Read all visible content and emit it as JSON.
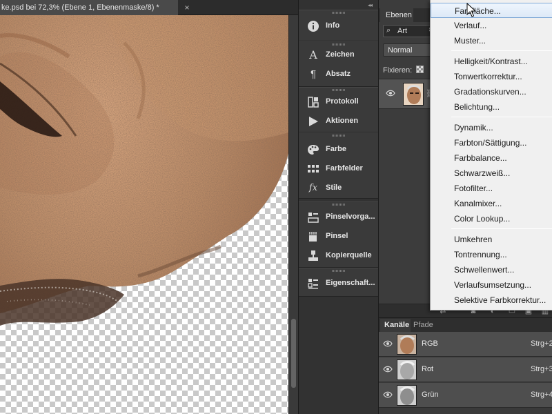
{
  "document": {
    "tab_title": "ke.psd bei 72,3% (Ebene 1, Ebenenmaske/8) *",
    "close_glyph": "×"
  },
  "dock": {
    "collapse_glyph": "◂◂",
    "groups": [
      {
        "items": [
          {
            "label": "Info",
            "icon": "info-icon"
          }
        ]
      },
      {
        "items": [
          {
            "label": "Zeichen",
            "icon": "character-icon"
          },
          {
            "label": "Absatz",
            "icon": "paragraph-icon"
          }
        ]
      },
      {
        "items": [
          {
            "label": "Protokoll",
            "icon": "history-icon"
          },
          {
            "label": "Aktionen",
            "icon": "actions-play-icon"
          }
        ]
      },
      {
        "items": [
          {
            "label": "Farbe",
            "icon": "color-palette-icon"
          },
          {
            "label": "Farbfelder",
            "icon": "swatches-icon"
          },
          {
            "label": "Stile",
            "icon": "styles-fx-icon"
          }
        ]
      },
      {
        "items": [
          {
            "label": "Pinselvorga...",
            "icon": "brush-presets-icon"
          },
          {
            "label": "Pinsel",
            "icon": "brush-icon"
          },
          {
            "label": "Kopierquelle",
            "icon": "clone-source-icon"
          }
        ]
      },
      {
        "items": [
          {
            "label": "Eigenschaft...",
            "icon": "properties-icon"
          }
        ]
      }
    ]
  },
  "layers": {
    "tab_label": "Ebenen",
    "filter": {
      "label": "Art",
      "icon": "search-icon"
    },
    "blend_mode": "Normal",
    "lock_label": "Fixieren:"
  },
  "channels": {
    "tabs": [
      "Kanäle",
      "Pfade"
    ],
    "rows": [
      {
        "name": "RGB",
        "shortcut": "Strg+2"
      },
      {
        "name": "Rot",
        "shortcut": "Strg+3"
      },
      {
        "name": "Grün",
        "shortcut": "Strg+4"
      }
    ]
  },
  "menu": {
    "groups": [
      [
        "Farbfläche...",
        "Verlauf...",
        "Muster..."
      ],
      [
        "Helligkeit/Kontrast...",
        "Tonwertkorrektur...",
        "Gradationskurven...",
        "Belichtung..."
      ],
      [
        "Dynamik...",
        "Farbton/Sättigung...",
        "Farbbalance...",
        "Schwarzweiß...",
        "Fotofilter...",
        "Kanalmixer...",
        "Color Lookup..."
      ],
      [
        "Umkehren",
        "Tontrennung...",
        "Schwellenwert...",
        "Verlaufsumsetzung...",
        "Selektive Farbkorrektur..."
      ]
    ],
    "hover_index": 0
  },
  "colors": {
    "skin": "#b98a66",
    "panel_bg": "#3c3c3c",
    "menu_bg": "#f0f0f0",
    "menu_hover_border": "#7ea8d6"
  }
}
